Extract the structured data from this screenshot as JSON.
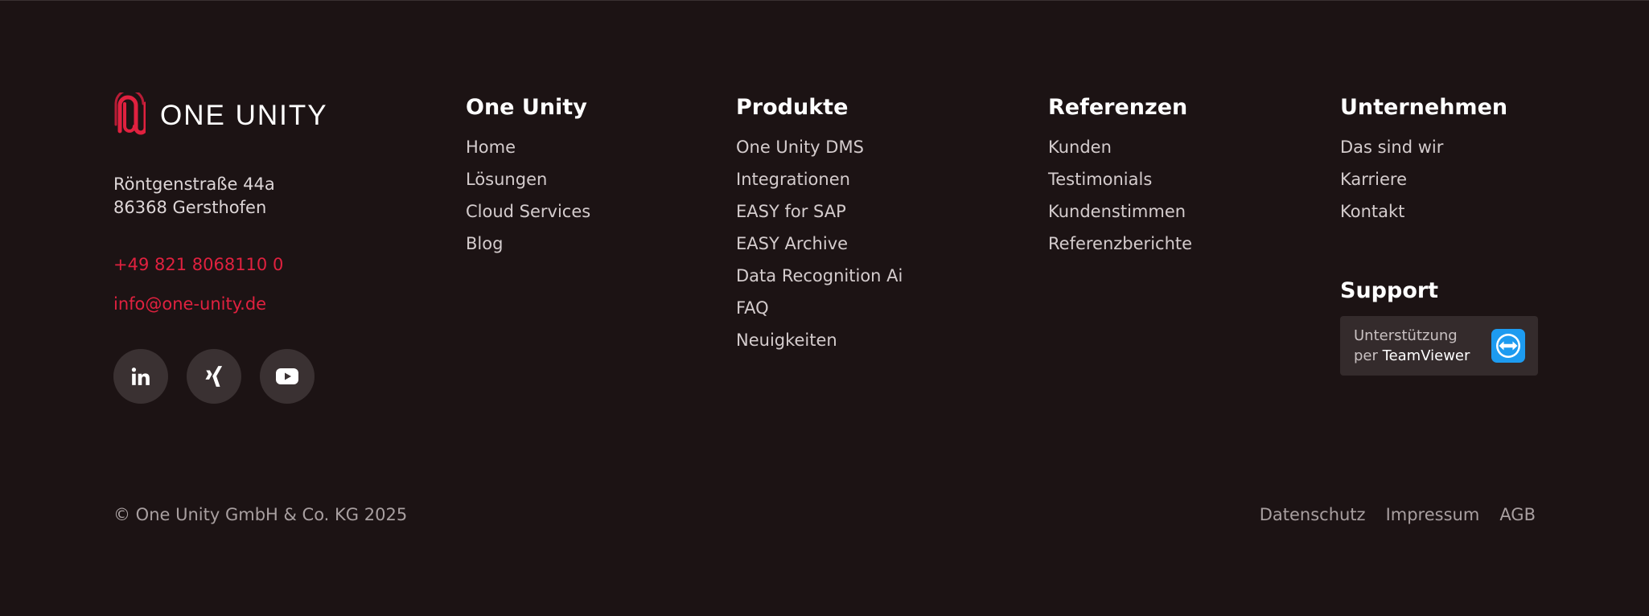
{
  "brand": {
    "name": "ONE UNITY",
    "address_line1": "Röntgenstraße 44a",
    "address_line2": "86368 Gersthofen",
    "phone": "+49 821 8068110 0",
    "email": "info@one-unity.de",
    "accent_color": "#e0213f",
    "socials": [
      {
        "icon": "linkedin-icon"
      },
      {
        "icon": "xing-icon"
      },
      {
        "icon": "youtube-icon"
      }
    ]
  },
  "columns": [
    {
      "title": "One Unity",
      "links": [
        "Home",
        "Lösungen",
        "Cloud Services",
        "Blog"
      ]
    },
    {
      "title": "Produkte",
      "links": [
        "One Unity DMS",
        "Integrationen",
        "EASY for SAP",
        "EASY Archive",
        "Data Recognition Ai",
        "FAQ",
        "Neuigkeiten"
      ]
    },
    {
      "title": "Referenzen",
      "links": [
        "Kunden",
        "Testimonials",
        "Kundenstimmen",
        "Referenzberichte"
      ]
    },
    {
      "title": "Unternehmen",
      "links": [
        "Das sind wir",
        "Karriere",
        "Kontakt"
      ]
    }
  ],
  "support": {
    "title": "Support",
    "line1": "Unterstützung",
    "line2_prefix": "per",
    "line2_brand": "TeamViewer",
    "icon": "teamviewer-icon"
  },
  "footer": {
    "copyright": "© One Unity GmbH & Co. KG 2025",
    "legal": [
      "Datenschutz",
      "Impressum",
      "AGB"
    ]
  }
}
